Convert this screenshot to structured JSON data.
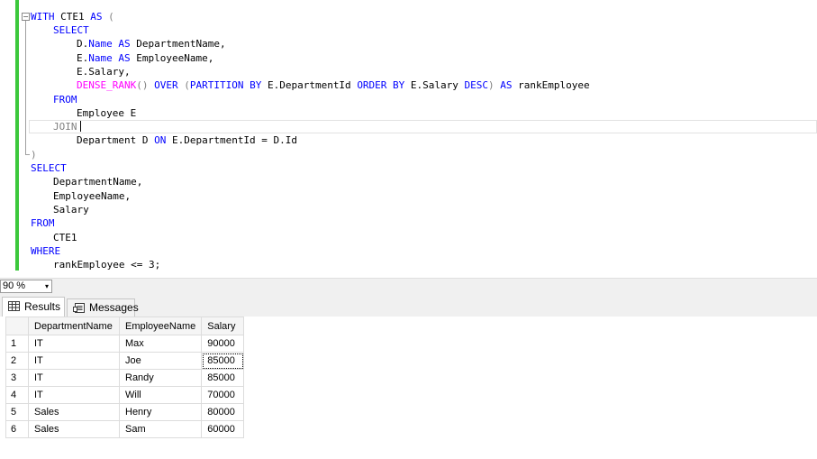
{
  "editor": {
    "collapse_glyph": "−",
    "lines": {
      "l1_with": "WITH",
      "l1_cte": " CTE1 ",
      "l1_as": "AS",
      "l1_paren": " (",
      "l2_select": "SELECT",
      "l3_pre": "D.",
      "l3_name": "Name",
      "l3_as": " AS",
      "l3_post": " DepartmentName,",
      "l4_pre": "E.",
      "l4_name": "Name",
      "l4_as": " AS",
      "l4_post": " EmployeeName,",
      "l5": "E.Salary,",
      "l6_fn": "DENSE_RANK",
      "l6_a": "() ",
      "l6_over": "OVER",
      "l6_b": " (",
      "l6_partition": "PARTITION BY",
      "l6_c": " E.DepartmentId ",
      "l6_order": "ORDER BY",
      "l6_d": " E.Salary ",
      "l6_desc": "DESC",
      "l6_e": ") ",
      "l6_as": "AS",
      "l6_f": " rankEmployee",
      "l7_from": "FROM",
      "l8": "Employee E",
      "l9_join": "JOIN",
      "l10_a": "Department D ",
      "l10_on": "ON",
      "l10_b": " E.DepartmentId = D.Id",
      "l11": ")",
      "l12_select": "SELECT",
      "l13": "DepartmentName,",
      "l14": "EmployeeName,",
      "l15": "Salary",
      "l16_from": "FROM",
      "l17": "CTE1",
      "l18_where": "WHERE",
      "l19": "rankEmployee <= 3;"
    }
  },
  "zoom": {
    "value": "90 %",
    "arrow": "▾"
  },
  "tabs": [
    {
      "label": "Results",
      "icon": "grid-icon"
    },
    {
      "label": "Messages",
      "icon": "message-icon"
    }
  ],
  "results": {
    "columns": [
      "DepartmentName",
      "EmployeeName",
      "Salary"
    ],
    "rows": [
      {
        "num": "1",
        "DepartmentName": "IT",
        "EmployeeName": "Max",
        "Salary": "90000"
      },
      {
        "num": "2",
        "DepartmentName": "IT",
        "EmployeeName": "Joe",
        "Salary": "85000"
      },
      {
        "num": "3",
        "DepartmentName": "IT",
        "EmployeeName": "Randy",
        "Salary": "85000"
      },
      {
        "num": "4",
        "DepartmentName": "IT",
        "EmployeeName": "Will",
        "Salary": "70000"
      },
      {
        "num": "5",
        "DepartmentName": "Sales",
        "EmployeeName": "Henry",
        "Salary": "80000"
      },
      {
        "num": "6",
        "DepartmentName": "Sales",
        "EmployeeName": "Sam",
        "Salary": "60000"
      }
    ]
  }
}
